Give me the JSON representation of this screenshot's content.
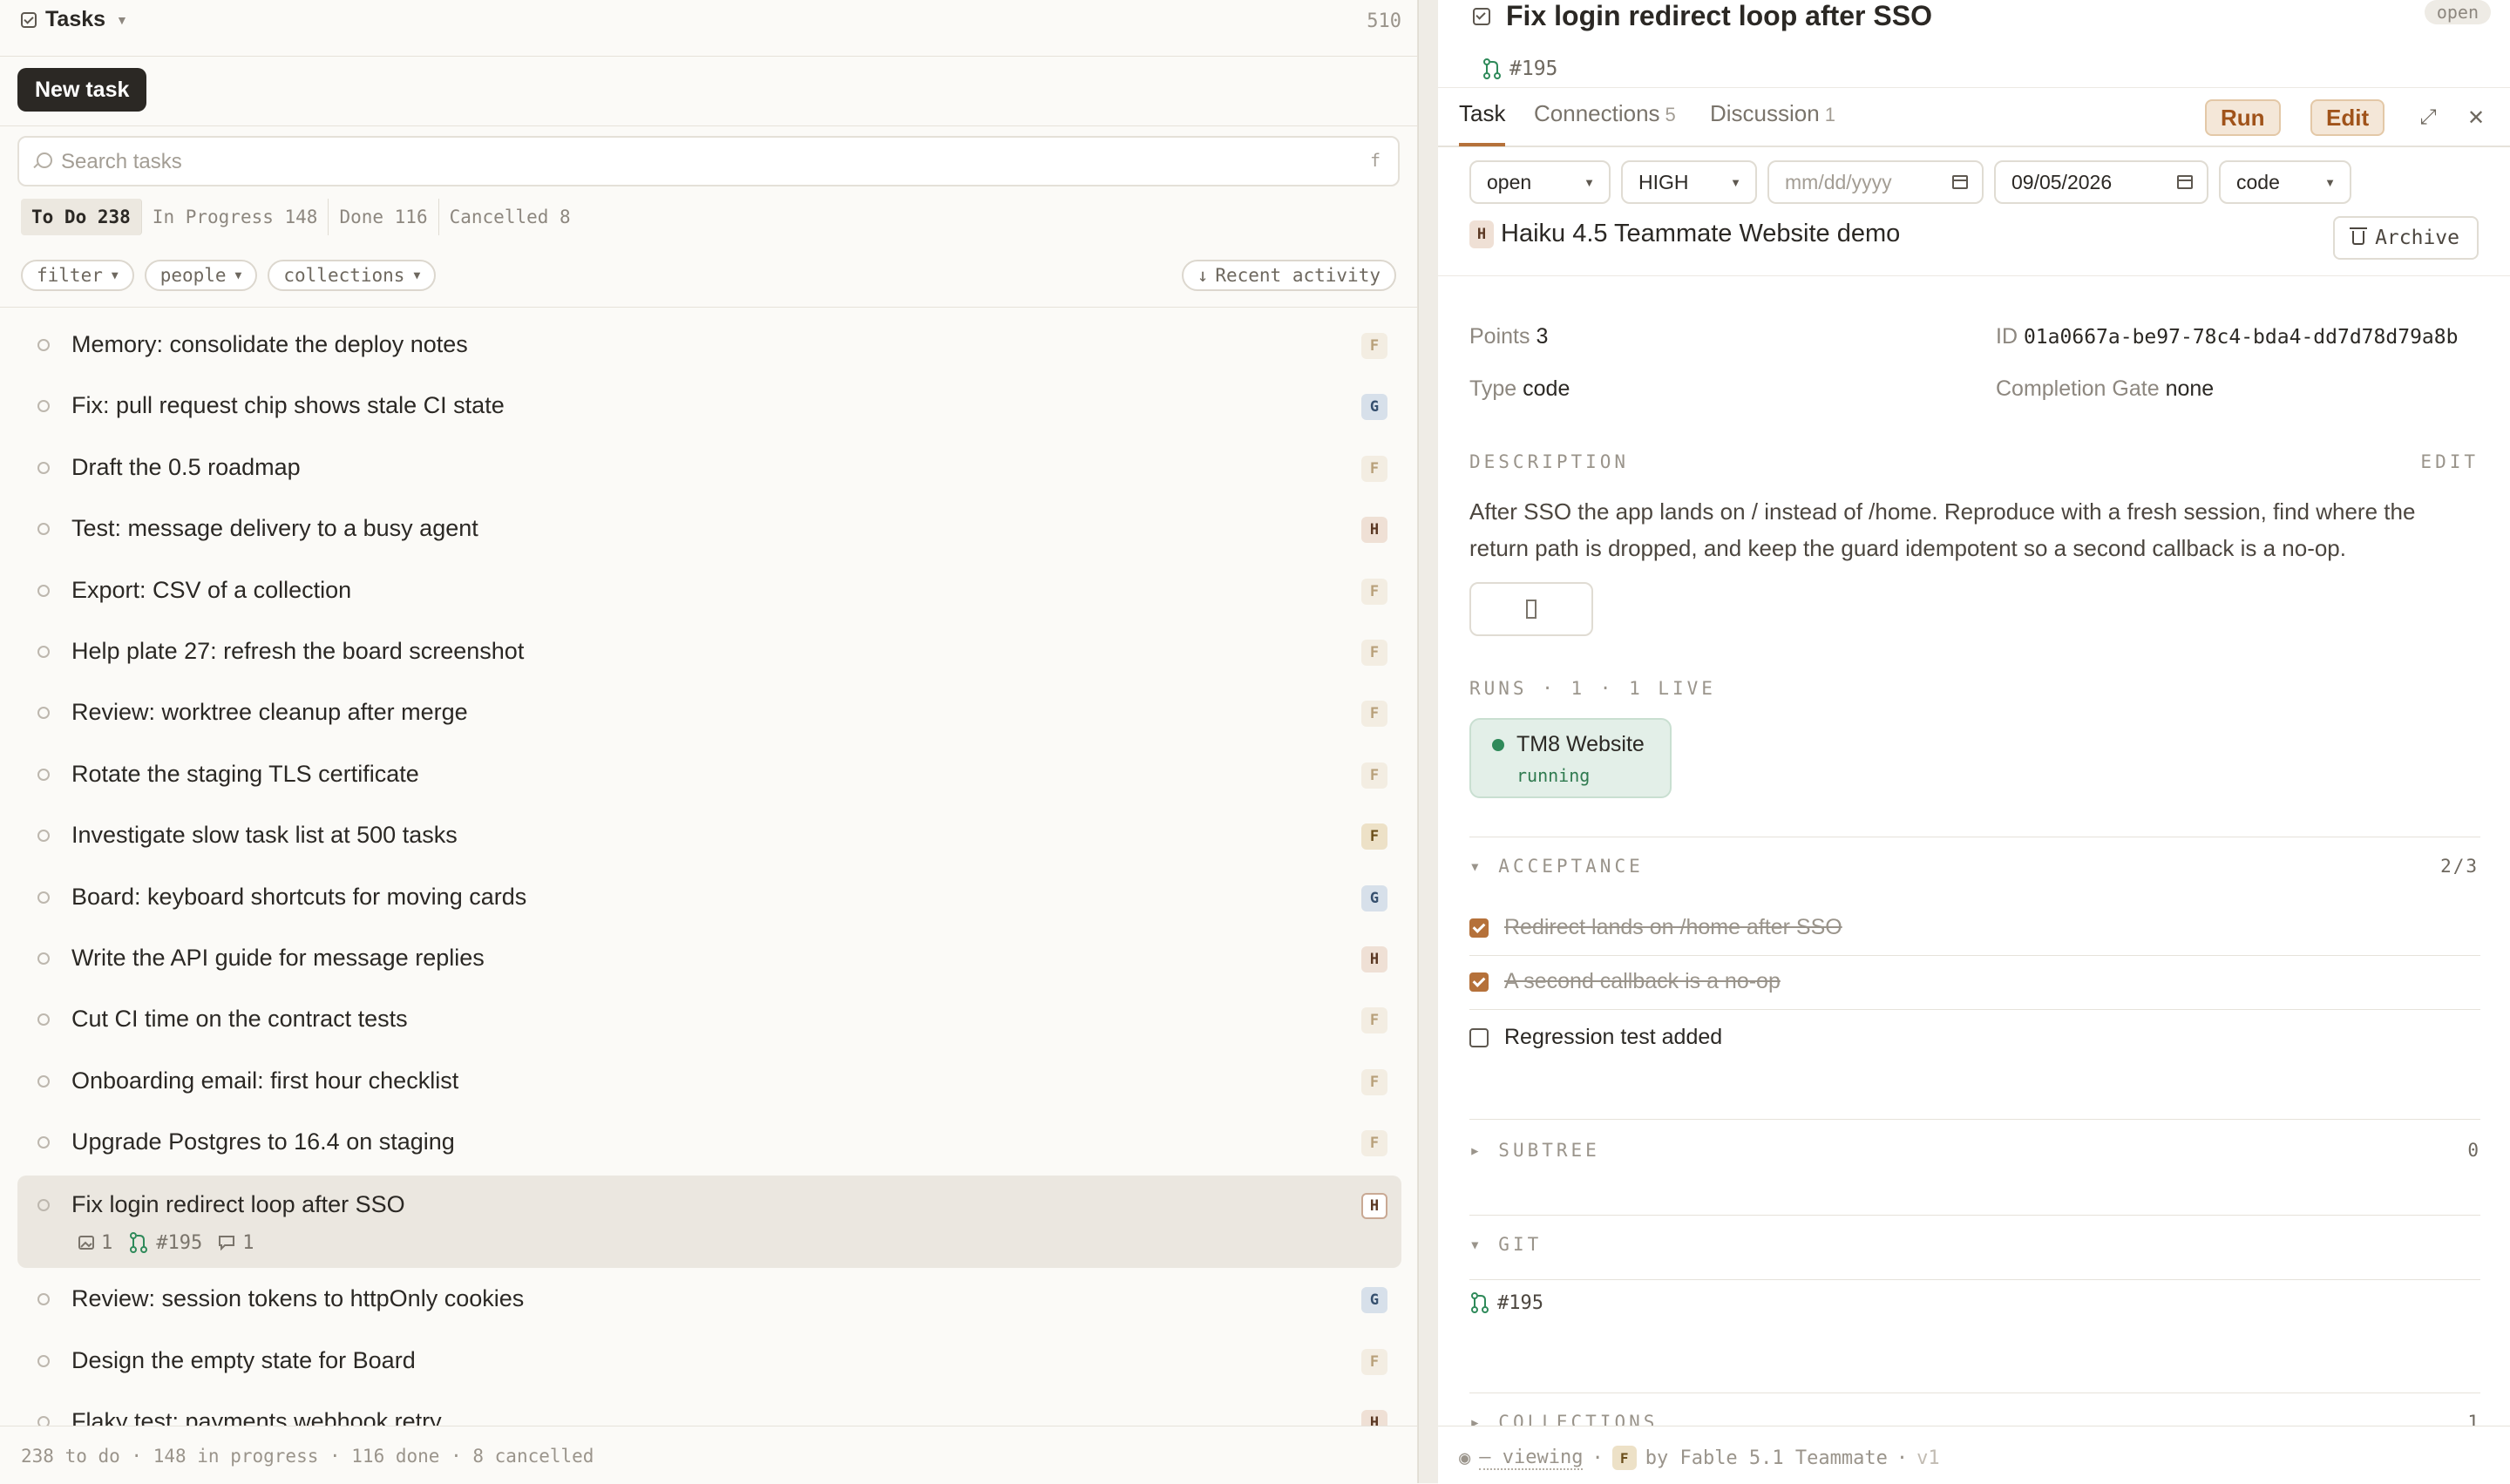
{
  "left": {
    "header": {
      "title": "Tasks",
      "total": "510"
    },
    "new_task_label": "New task",
    "search": {
      "placeholder": "Search tasks",
      "shortcut": "f"
    },
    "status_tabs": [
      {
        "label": "To Do 238"
      },
      {
        "label": "In Progress 148"
      },
      {
        "label": "Done 116"
      },
      {
        "label": "Cancelled 8"
      }
    ],
    "filters": {
      "filter": "filter",
      "people": "people",
      "collections": "collections",
      "sort": "Recent activity"
    },
    "tasks": [
      {
        "title": "Memory: consolidate the deploy notes",
        "avatar": "F"
      },
      {
        "title": "Fix: pull request chip shows stale CI state",
        "avatar": "G"
      },
      {
        "title": "Draft the 0.5 roadmap",
        "avatar": "F"
      },
      {
        "title": "Test: message delivery to a busy agent",
        "avatar": "H"
      },
      {
        "title": "Export: CSV of a collection",
        "avatar": "F"
      },
      {
        "title": "Help plate 27: refresh the board screenshot",
        "avatar": "F"
      },
      {
        "title": "Review: worktree cleanup after merge",
        "avatar": "F"
      },
      {
        "title": "Rotate the staging TLS certificate",
        "avatar": "F"
      },
      {
        "title": "Investigate slow task list at 500 tasks",
        "avatar": "F"
      },
      {
        "title": "Board: keyboard shortcuts for moving cards",
        "avatar": "G"
      },
      {
        "title": "Write the API guide for message replies",
        "avatar": "H"
      },
      {
        "title": "Cut CI time on the contract tests",
        "avatar": "F"
      },
      {
        "title": "Onboarding email: first hour checklist",
        "avatar": "F"
      },
      {
        "title": "Upgrade Postgres to 16.4 on staging",
        "avatar": "F"
      },
      {
        "title": "Fix login redirect loop after SSO",
        "avatar": "H",
        "selected": true,
        "attachments": "1",
        "pr": "#195",
        "comments": "1"
      },
      {
        "title": "Review: session tokens to httpOnly cookies",
        "avatar": "G"
      },
      {
        "title": "Design the empty state for Board",
        "avatar": "F"
      },
      {
        "title": "Flaky test: payments webhook retry",
        "avatar": "H"
      }
    ],
    "footer": "238 to do · 148 in progress · 116 done · 8 cancelled"
  },
  "detail": {
    "title": "Fix login redirect loop after SSO",
    "status_pill": "open",
    "pr": "#195",
    "tabs": [
      {
        "label": "Task",
        "count": ""
      },
      {
        "label": "Connections",
        "count": "5"
      },
      {
        "label": "Discussion",
        "count": "1"
      }
    ],
    "run_label": "Run",
    "edit_label": "Edit",
    "fields": {
      "status": "open",
      "priority": "HIGH",
      "start_placeholder": "mm/dd/yyyy",
      "due": "09/05/2026",
      "type": "code"
    },
    "assignee": {
      "avatar": "H",
      "name": "Haiku 4.5 Teammate",
      "project": "Website demo"
    },
    "archive_label": "Archive",
    "props": {
      "points_label": "Points",
      "points": "3",
      "id_label": "ID",
      "id": "01a0667a-be97-78c4-bda4-dd7d78d79a8b",
      "type_label": "Type",
      "type": "code",
      "gate_label": "Completion Gate",
      "gate": "none"
    },
    "description_heading": "DESCRIPTION",
    "description_edit": "EDIT",
    "description": "After SSO the app lands on / instead of /home. Reproduce with a fresh session, find where the return path is dropped, and keep the guard idempotent so a second callback is a no-op.",
    "runs_heading": "RUNS · 1 · 1 LIVE",
    "run": {
      "name": "TM8 Website",
      "state": "running"
    },
    "acceptance_heading": "ACCEPTANCE",
    "acceptance_count": "2/3",
    "acceptance": [
      {
        "text": "Redirect lands on /home after SSO",
        "done": true
      },
      {
        "text": "A second callback is a no-op",
        "done": true
      },
      {
        "text": "Regression test added",
        "done": false
      }
    ],
    "subtree_heading": "SUBTREE",
    "subtree_count": "0",
    "git_heading": "GIT",
    "git_pr": "#195",
    "collections_heading": "COLLECTIONS",
    "collections_count": "1",
    "footer": {
      "viewing": "— viewing",
      "avatar": "F",
      "by": "by Fable 5.1 Teammate",
      "version": "v1"
    }
  },
  "colors": {
    "accent": "#b5713a",
    "dark_button": "#2b2824",
    "run_green": "#2f8a5a"
  }
}
